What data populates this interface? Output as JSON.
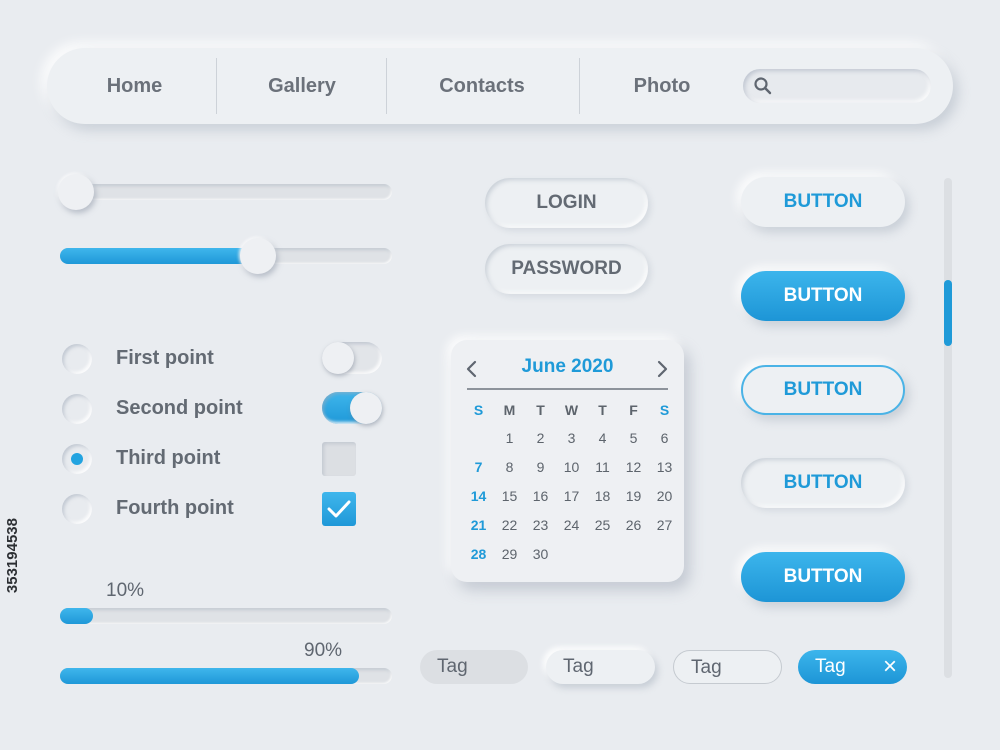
{
  "nav": {
    "items": [
      {
        "label": "Home"
      },
      {
        "label": "Gallery"
      },
      {
        "label": "Contacts"
      },
      {
        "label": "Photo"
      }
    ],
    "search": {
      "icon": "search-icon",
      "placeholder": ""
    }
  },
  "sliders": [
    {
      "value": 0.05
    },
    {
      "value": 0.6
    }
  ],
  "options": [
    {
      "label": "First point",
      "selected": false,
      "control": "toggle",
      "on": false
    },
    {
      "label": "Second point",
      "selected": false,
      "control": "toggle",
      "on": true
    },
    {
      "label": "Third point",
      "selected": true,
      "control": "checkbox",
      "on": false
    },
    {
      "label": "Fourth point",
      "selected": false,
      "control": "checkbox",
      "on": true
    }
  ],
  "progress": [
    {
      "label": "10%",
      "value": 0.1
    },
    {
      "label": "90%",
      "value": 0.9
    }
  ],
  "auth": {
    "login_label": "LOGIN",
    "password_label": "PASSWORD"
  },
  "calendar": {
    "month": "June 2020",
    "weekdays": [
      "S",
      "M",
      "T",
      "W",
      "T",
      "F",
      "S"
    ],
    "weeks": [
      [
        "",
        "1",
        "2",
        "3",
        "4",
        "5",
        "6"
      ],
      [
        "7",
        "8",
        "9",
        "10",
        "11",
        "12",
        "13"
      ],
      [
        "14",
        "15",
        "16",
        "17",
        "18",
        "19",
        "20"
      ],
      [
        "21",
        "22",
        "23",
        "24",
        "25",
        "26",
        "27"
      ],
      [
        "28",
        "29",
        "30",
        "",
        "",
        "",
        ""
      ]
    ]
  },
  "buttons": [
    {
      "label": "BUTTON",
      "style": "raised"
    },
    {
      "label": "BUTTON",
      "style": "solid"
    },
    {
      "label": "BUTTON",
      "style": "outline"
    },
    {
      "label": "BUTTON",
      "style": "inset"
    },
    {
      "label": "BUTTON",
      "style": "solid"
    }
  ],
  "tags": [
    {
      "label": "Tag",
      "style": "flat"
    },
    {
      "label": "Tag",
      "style": "raised"
    },
    {
      "label": "Tag",
      "style": "outlined"
    },
    {
      "label": "Tag",
      "style": "active",
      "close": "×"
    }
  ],
  "scrollbar": {
    "position": 0.22
  },
  "colors": {
    "accent": "#1f9ad8",
    "background": "#e9ecf0",
    "text": "#5f6670"
  },
  "stock_id": "353194538"
}
